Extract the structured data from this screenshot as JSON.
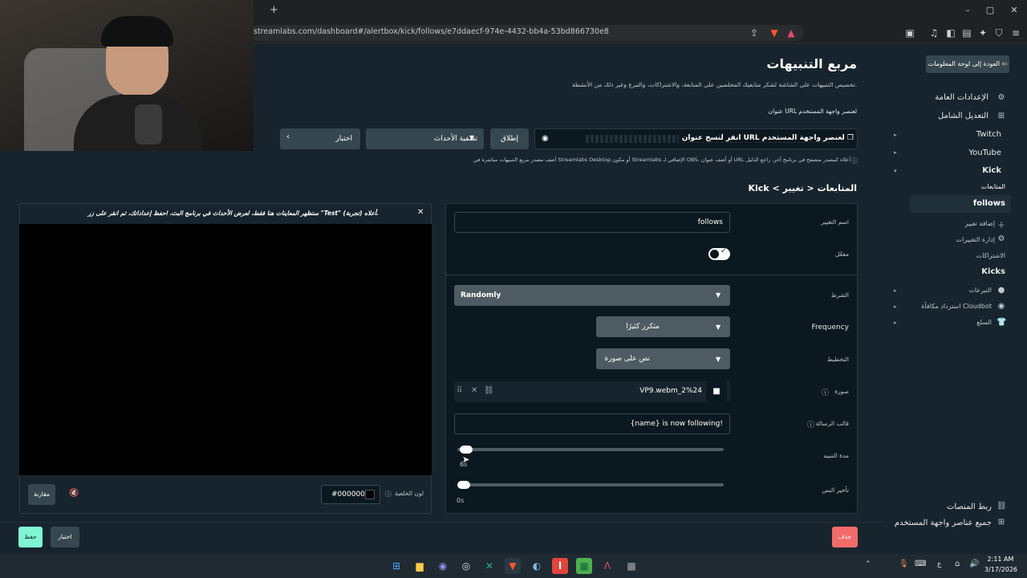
{
  "browser": {
    "url": "streamlabs.com/dashboard#/alertbox/kick/follows/e7ddaecf-974e-4432-bb4a-53bd866730e8",
    "new_tab": "+"
  },
  "sidebar": {
    "back_label": "العودة إلى لوحة المعلومات",
    "items": [
      {
        "label": "الإعدادات العامة"
      },
      {
        "label": "التعديل الشامل"
      },
      {
        "label": "Twitch"
      },
      {
        "label": "YouTube"
      },
      {
        "label": "Kick"
      },
      {
        "label": "المتابعات"
      },
      {
        "label": "follows"
      },
      {
        "label": "إضافة تغيير"
      },
      {
        "label": "إدارة التغييرات"
      },
      {
        "label": "الاشتراكات"
      },
      {
        "label": "Kicks"
      },
      {
        "label": "التبرعات"
      },
      {
        "label": "استرداد مكافأة Cloudbot"
      },
      {
        "label": "السلع"
      }
    ],
    "connect_platforms": "ربط المنصات",
    "all_widgets": "جميع عناصر واجهة المستخدم"
  },
  "main": {
    "title": "مربع التنبيهات",
    "description": "تخصيص التنبيهات على الشاشة لشكر متابعيك المخلصين على المتابعة، والاشتراكات، والتبرع وغير ذلك من الأنشطة.",
    "url_label": "عنوان URL لعنصر واجهة المستخدم",
    "copy_url": "انقر لنسخ عنوان URL لعنصر واجهة المستخدم",
    "launch": "إطلاق",
    "filter_events": "تصفية الأحداث",
    "test": "اختبار",
    "help_text": "أضف مصدر مربع التنبيهات مباشرة في Streamlabs Desktop أو مكون Streamlabs الإضافي لـ OBS، أو أضف عنوان URL أعلاه كمصدر متصفح في برنامج آخر. راجع الدليل",
    "breadcrumb": "Kick < المتابعات < تغيير"
  },
  "preview": {
    "notice": "ستظهر المعاينات هنا فقط، لعرض الأحداث في برنامج البث، احفظ إعداداتك، ثم انقر على زر \"Test\" (تجربة) أعلاه.",
    "bg_label": "لون الخلفية",
    "bg_value": "#000000",
    "compare": "مقارنة"
  },
  "settings": {
    "name_label": "اسم التغيير",
    "name_value": "follows",
    "enabled_label": "مفعّل",
    "condition_label": "الشرط",
    "condition_value": "Randomly",
    "frequency_label": "Frequency",
    "frequency_value": "متكرر كثيرًا",
    "layout_label": "التخطيط",
    "layout_value": "نص على صورة",
    "image_label": "صورة",
    "image_value": "VP9.webm_2%24",
    "message_label": "قالب الرسالة",
    "message_value": "{name} is now following!",
    "duration_label": "مدة التنبيه",
    "duration_value": "6s",
    "duration_fraction": 0.01,
    "delay_label": "تأخير النص",
    "delay_value": "0s",
    "delay_fraction": 0.0
  },
  "bottom": {
    "delete": "حذف",
    "save": "حفظ",
    "test": "اختبار"
  },
  "taskbar": {
    "time": "2:11 AM",
    "date": "3/17/2026",
    "lang": "ع"
  },
  "colors": {
    "accent": "#80f5d2",
    "danger": "#f26b6b",
    "panel": "#0c181f",
    "bg": "#17242d"
  }
}
